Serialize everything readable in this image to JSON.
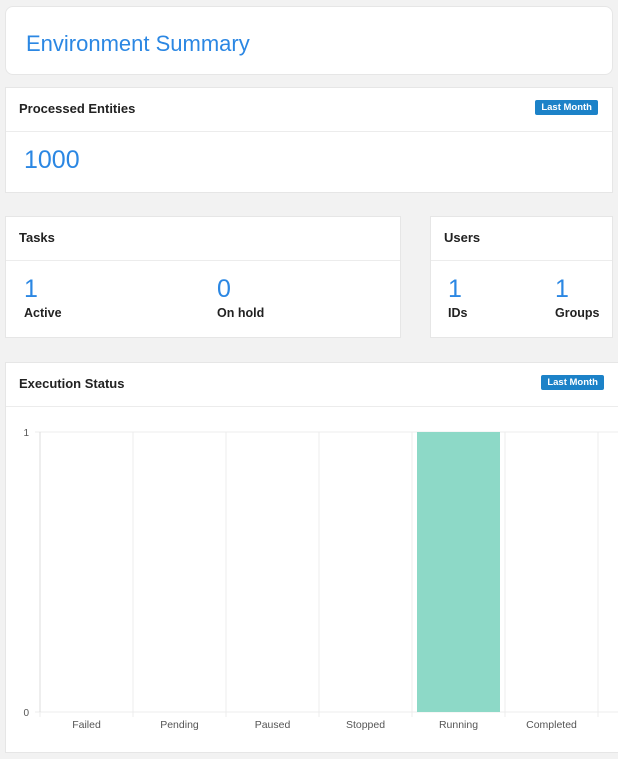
{
  "header": {
    "title": "Environment Summary"
  },
  "processed": {
    "title": "Processed Entities",
    "badge": "Last Month",
    "value": "1000"
  },
  "tasks": {
    "title": "Tasks",
    "stats": [
      {
        "value": "1",
        "label": "Active"
      },
      {
        "value": "0",
        "label": "On hold"
      }
    ]
  },
  "users": {
    "title": "Users",
    "stats": [
      {
        "value": "1",
        "label": "IDs"
      },
      {
        "value": "1",
        "label": "Groups"
      }
    ]
  },
  "execution": {
    "title": "Execution Status",
    "badge": "Last Month"
  },
  "chart_data": {
    "type": "bar",
    "categories": [
      "Failed",
      "Pending",
      "Paused",
      "Stopped",
      "Running",
      "Completed"
    ],
    "values": [
      0,
      0,
      0,
      0,
      1,
      0
    ],
    "ylim": [
      0,
      1
    ],
    "yticks": [
      "0",
      "1"
    ],
    "bar_color": "#8dd9c7",
    "grid": true
  }
}
